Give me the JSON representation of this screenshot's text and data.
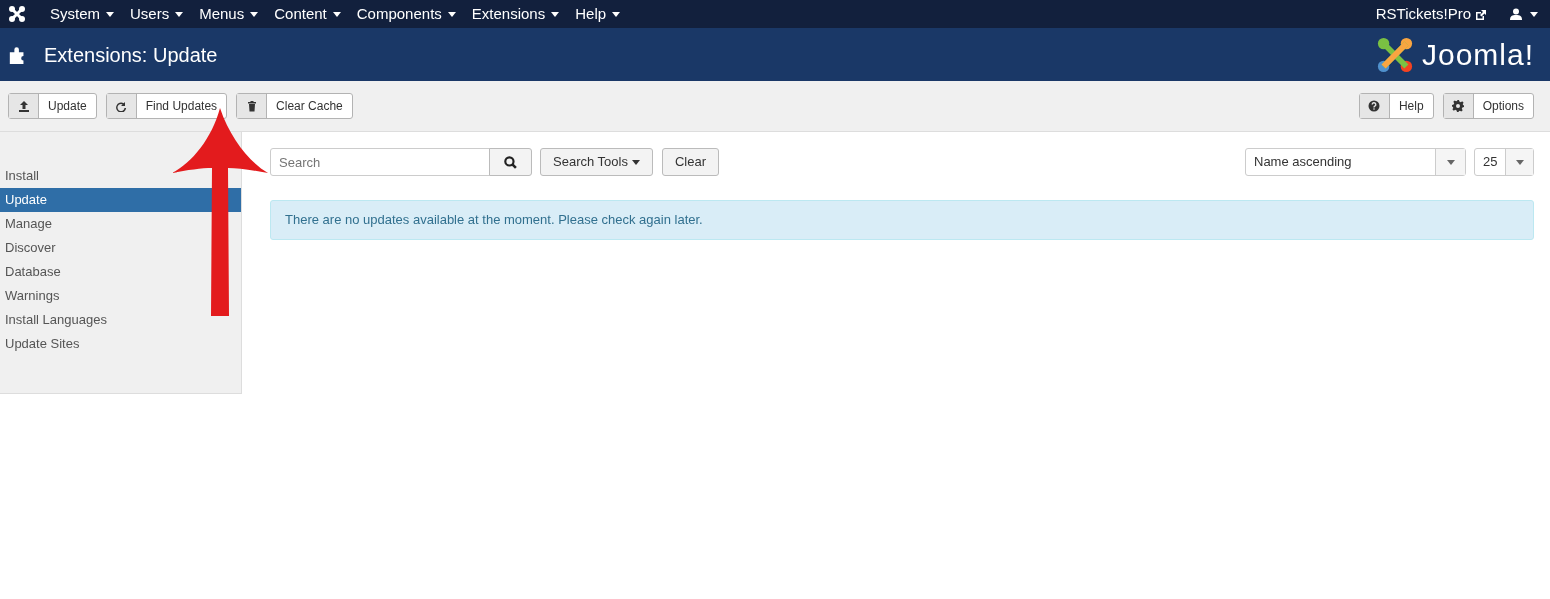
{
  "top_menu": [
    {
      "label": "System"
    },
    {
      "label": "Users"
    },
    {
      "label": "Menus"
    },
    {
      "label": "Content"
    },
    {
      "label": "Components"
    },
    {
      "label": "Extensions"
    },
    {
      "label": "Help"
    }
  ],
  "site_link": "RSTickets!Pro",
  "header": {
    "title": "Extensions: Update",
    "logo": "Joomla!"
  },
  "toolbar": {
    "left": [
      {
        "label": "Update"
      },
      {
        "label": "Find Updates"
      },
      {
        "label": "Clear Cache"
      }
    ],
    "right": [
      {
        "label": "Help"
      },
      {
        "label": "Options"
      }
    ]
  },
  "sidebar": {
    "items": [
      {
        "label": "Install",
        "selected": false
      },
      {
        "label": "Update",
        "selected": true
      },
      {
        "label": "Manage",
        "selected": false
      },
      {
        "label": "Discover",
        "selected": false
      },
      {
        "label": "Database",
        "selected": false
      },
      {
        "label": "Warnings",
        "selected": false
      },
      {
        "label": "Install Languages",
        "selected": false
      },
      {
        "label": "Update Sites",
        "selected": false
      }
    ]
  },
  "filters": {
    "search": {
      "placeholder": "Search"
    },
    "search_tools": "Search Tools",
    "clear": "Clear",
    "ordering": "Name ascending",
    "limit": "25"
  },
  "alert": "There are no updates available at the moment. Please check again later."
}
